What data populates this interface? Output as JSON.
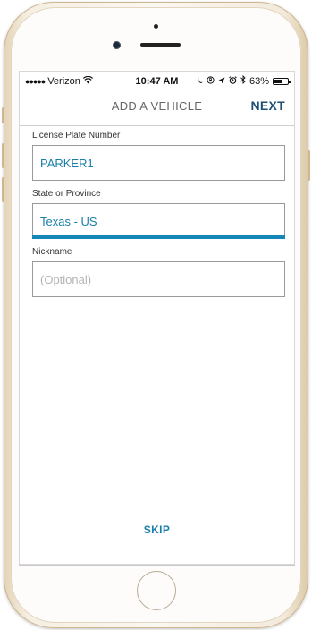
{
  "status_bar": {
    "carrier": "Verizon",
    "time": "10:47 AM",
    "battery": "63%",
    "battery_level": 0.63
  },
  "nav": {
    "title": "ADD A VEHICLE",
    "next_label": "NEXT"
  },
  "form": {
    "license_plate": {
      "label": "License Plate Number",
      "value": "PARKER1"
    },
    "state": {
      "label": "State or Province",
      "value": "Texas - US"
    },
    "nickname": {
      "label": "Nickname",
      "placeholder": "(Optional)",
      "value": ""
    }
  },
  "skip_label": "SKIP",
  "colors": {
    "accent": "#1486b8",
    "nav_next": "#1c4f73",
    "value_text": "#1a7fa8"
  },
  "icons": {
    "signal": "signal-dots-icon",
    "wifi": "wifi-icon",
    "moon": "moon-icon",
    "orientation_lock": "orientation-lock-icon",
    "location": "location-arrow-icon",
    "alarm": "alarm-icon",
    "bluetooth": "bluetooth-icon",
    "battery": "battery-icon"
  }
}
